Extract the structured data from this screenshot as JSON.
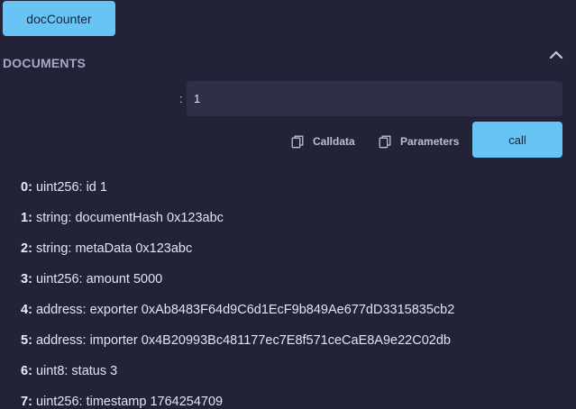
{
  "function": {
    "name": "docCounter"
  },
  "section": {
    "title": "DOCUMENTS"
  },
  "input": {
    "label": ":",
    "value": "1"
  },
  "actions": {
    "calldata_label": "Calldata",
    "parameters_label": "Parameters",
    "call_label": "call"
  },
  "results": [
    {
      "index": "0:",
      "text": "uint256: id 1"
    },
    {
      "index": "1:",
      "text": "string: documentHash 0x123abc"
    },
    {
      "index": "2:",
      "text": "string: metaData 0x123abc"
    },
    {
      "index": "3:",
      "text": "uint256: amount 5000"
    },
    {
      "index": "4:",
      "text": "address: exporter 0xAb8483F64d9C6d1EcF9b849Ae677dD3315835cb2"
    },
    {
      "index": "5:",
      "text": "address: importer 0x4B20993Bc481177ec7E8f571ceCaE8A9e22C02db"
    },
    {
      "index": "6:",
      "text": "uint8: status 3"
    },
    {
      "index": "7:",
      "text": "uint256: timestamp 1764254709"
    }
  ],
  "icons": {
    "collapse": "chevron-up-icon",
    "copy": "copy-icon"
  },
  "colors": {
    "background": "#222336",
    "accent": "#68c4f5",
    "input_bg": "#2e3048",
    "muted_text": "#a8a9c8"
  }
}
